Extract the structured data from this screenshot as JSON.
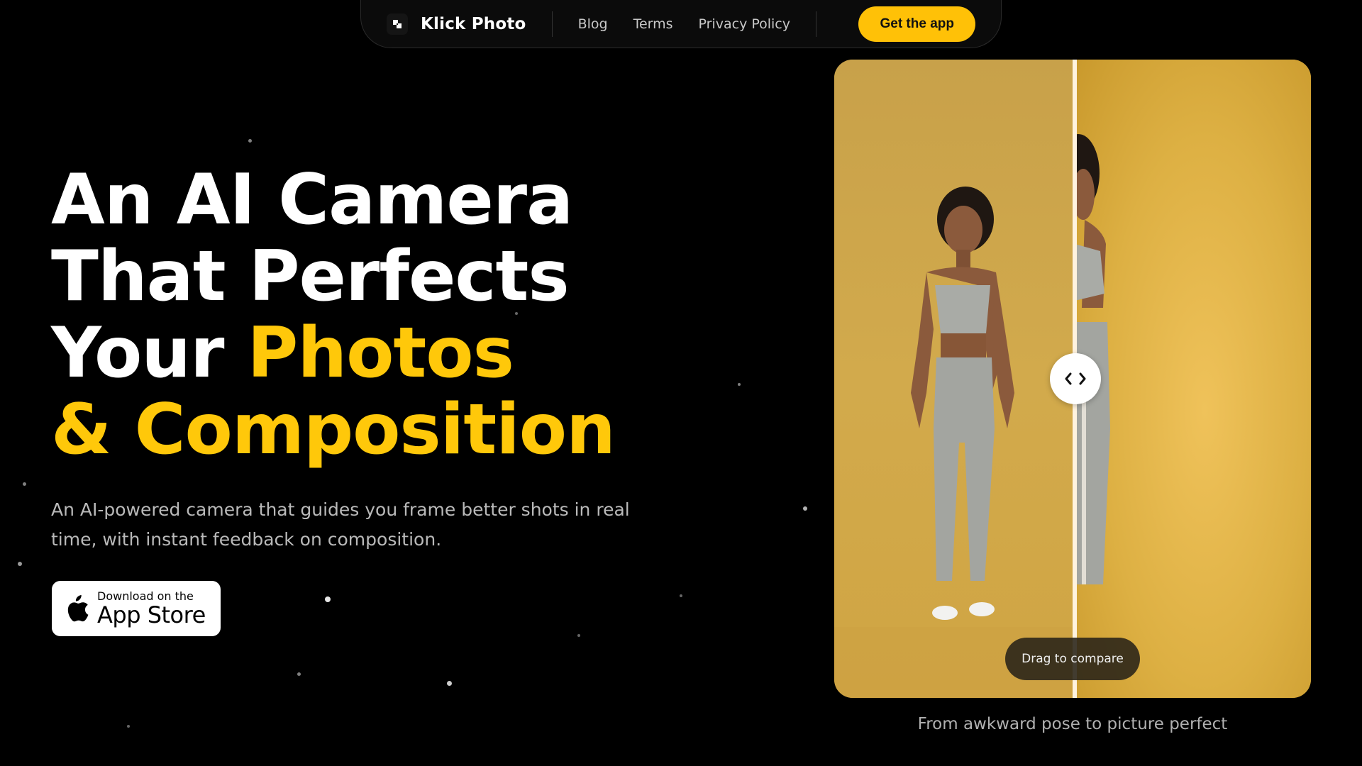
{
  "nav": {
    "brand": "Klick Photo",
    "links": [
      "Blog",
      "Terms",
      "Privacy Policy"
    ],
    "cta": "Get the app"
  },
  "hero": {
    "line1": "An AI Camera",
    "line2": "That Perfects",
    "line3_plain": "Your ",
    "line3_accent": "Photos",
    "line4_accent": "& Composition",
    "subtitle": "An AI-powered camera that guides you frame better shots in real time, with instant feedback on composition.",
    "store_small": "Download on the",
    "store_big": "App Store"
  },
  "compare": {
    "drag_label": "Drag to compare",
    "caption": "From awkward pose to picture perfect"
  },
  "colors": {
    "accent": "#ffc107",
    "background": "#000000"
  },
  "icons": {
    "logo": "klick-logo-icon",
    "apple": "apple-icon",
    "handle": "chevron-left-right-icon"
  }
}
